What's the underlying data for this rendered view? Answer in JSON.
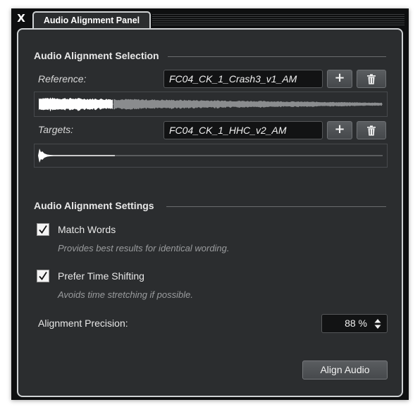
{
  "window": {
    "close_label": "X",
    "tab_label": "Audio Alignment Panel"
  },
  "selection": {
    "title": "Audio Alignment Selection",
    "reference": {
      "label": "Reference:",
      "value": "FC04_CK_1_Crash3_v1_AM",
      "add_label": "+",
      "delete_icon": "trash-icon"
    },
    "targets": {
      "label": "Targets:",
      "value": "FC04_CK_1_HHC_v2_AM",
      "add_label": "+",
      "delete_icon": "trash-icon"
    }
  },
  "settings": {
    "title": "Audio Alignment Settings",
    "match_words": {
      "label": "Match Words",
      "checked": true,
      "hint": "Provides best results for identical wording."
    },
    "prefer_time_shifting": {
      "label": "Prefer Time Shifting",
      "checked": true,
      "hint": "Avoids time stretching if possible."
    },
    "precision": {
      "label": "Alignment Precision:",
      "value": "88 %"
    }
  },
  "actions": {
    "align_label": "Align Audio"
  },
  "colors": {
    "panel_bg": "#2b2d2f",
    "frame_bg": "#0e0f10",
    "field_bg": "#121314",
    "waveform_bright": "#ffffff",
    "waveform_dim": "#8a8c8e"
  }
}
